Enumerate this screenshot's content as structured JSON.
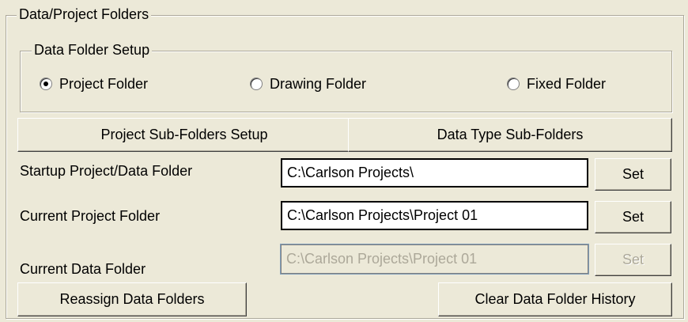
{
  "outer_group": {
    "title": "Data/Project Folders"
  },
  "data_folder_setup": {
    "title": "Data Folder Setup",
    "options": [
      {
        "label": "Project Folder",
        "checked": true
      },
      {
        "label": "Drawing Folder",
        "checked": false
      },
      {
        "label": "Fixed Folder",
        "checked": false
      }
    ]
  },
  "buttons": {
    "project_subfolders": "Project Sub-Folders Setup",
    "data_type_subfolders": "Data Type Sub-Folders",
    "reassign": "Reassign Data Folders",
    "clear_history": "Clear Data Folder History"
  },
  "rows": {
    "startup": {
      "label": "Startup Project/Data Folder",
      "value": "C:\\Carlson Projects\\",
      "set_label": "Set"
    },
    "current_project": {
      "label": "Current Project Folder",
      "value": "C:\\Carlson Projects\\Project 01",
      "set_label": "Set"
    },
    "current_data": {
      "label": "Current Data Folder",
      "value": "C:\\Carlson Projects\\Project 01",
      "set_label": "Set",
      "disabled": true
    }
  }
}
